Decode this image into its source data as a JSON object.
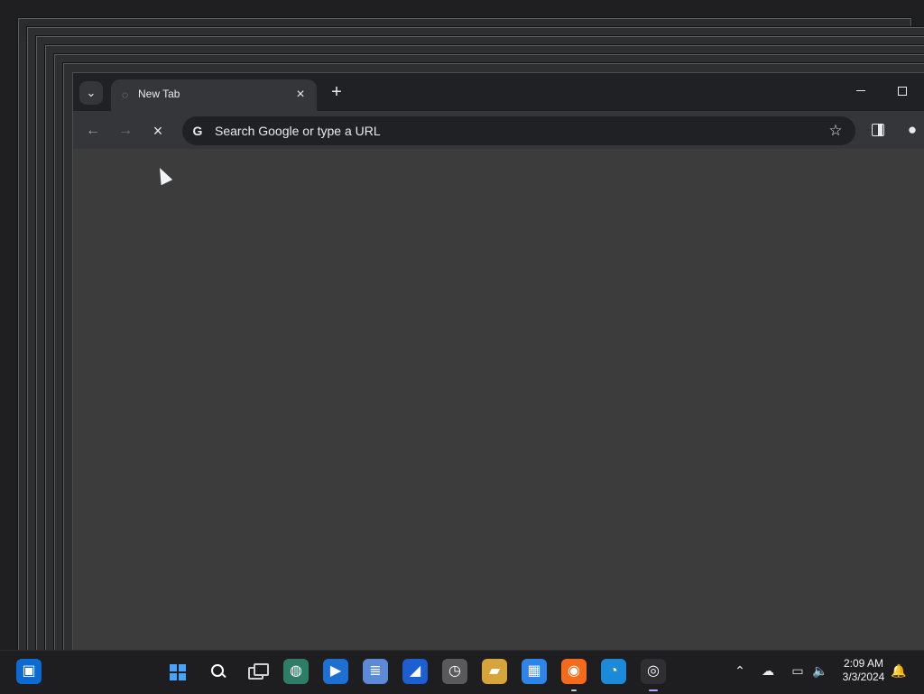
{
  "browser": {
    "tab_title": "New Tab",
    "address_placeholder": "Search Google or type a URL"
  },
  "taskbar": {
    "time": "2:09 AM",
    "date": "3/3/2024"
  }
}
